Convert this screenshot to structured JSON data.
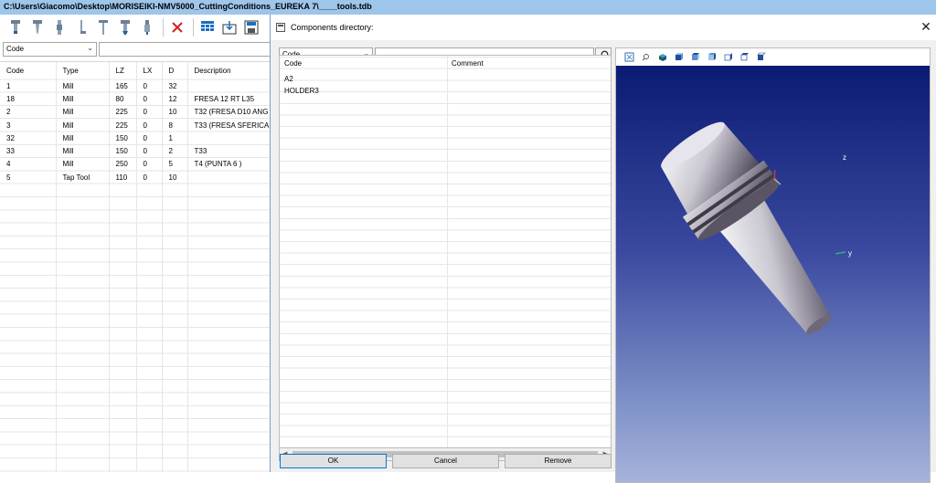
{
  "window": {
    "title": "C:\\Users\\Giacomo\\Desktop\\MORISEIKI-NMV5000_CuttingConditions_EUREKA 7\\____tools.tdb"
  },
  "toolbar": {
    "icons": [
      "tool-mill-icon",
      "tool-drill-icon",
      "tool-reamer-icon",
      "tool-bore-icon",
      "tool-tap-icon",
      "tool-chamfer-icon",
      "tool-thread-icon",
      "delete-icon",
      "grid-icon",
      "import-icon",
      "export-icon"
    ],
    "colors": {
      "delete": "#d42020",
      "accent": "#1a6fc4"
    }
  },
  "filter": {
    "field": "Code",
    "text": ""
  },
  "main_table": {
    "columns": [
      "Code",
      "Type",
      "LZ",
      "LX",
      "D",
      "Description"
    ],
    "rows": [
      [
        "1",
        "Mill",
        "165",
        "0",
        "32",
        ""
      ],
      [
        "18",
        "Mill",
        "80",
        "0",
        "12",
        "FRESA 12 RT L35"
      ],
      [
        "2",
        "Mill",
        "225",
        "0",
        "10",
        "T32 (FRESA D10 ANG"
      ],
      [
        "3",
        "Mill",
        "225",
        "0",
        "8",
        "T33 (FRESA SFERICA"
      ],
      [
        "32",
        "Mill",
        "150",
        "0",
        "1",
        ""
      ],
      [
        "33",
        "Mill",
        "150",
        "0",
        "2",
        "T33"
      ],
      [
        "4",
        "Mill",
        "250",
        "0",
        "5",
        "T4 (PUNTA 6 )"
      ],
      [
        "5",
        "Tap Tool",
        "110",
        "0",
        "10",
        ""
      ]
    ]
  },
  "dialog": {
    "title": "Components directory:",
    "filter_field": "Code",
    "filter_text": "",
    "columns": [
      "Code",
      "Comment"
    ],
    "rows": [
      {
        "code": "A2",
        "comment": ""
      },
      {
        "code": "HOLDER3",
        "comment": ""
      }
    ],
    "buttons": {
      "ok": "OK",
      "cancel": "Cancel",
      "remove": "Remove"
    }
  },
  "viewer": {
    "toolbar_icons": [
      "fit-all-icon",
      "zoom-icon",
      "view-iso-icon",
      "view-front-icon",
      "view-back-icon",
      "view-left-icon",
      "view-right-icon",
      "view-top-icon",
      "view-bottom-icon"
    ],
    "axis_labels": {
      "z": "z",
      "y": "y"
    },
    "background_top": "#0b1b73",
    "background_bottom": "#a6b3db"
  }
}
